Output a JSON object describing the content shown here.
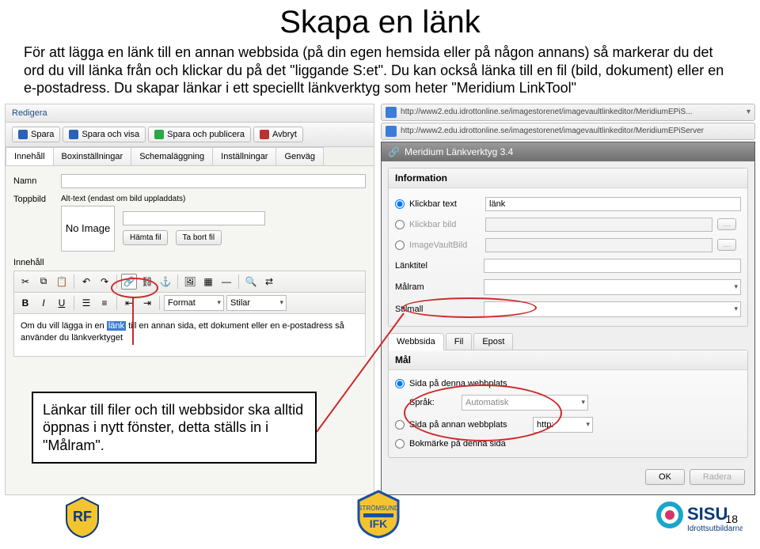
{
  "title": "Skapa en länk",
  "intro": "För att lägga en länk till en annan webbsida (på din egen hemsida eller på någon annans) så markerar du det ord du vill länka från och klickar du på det \"liggande S:et\". Du kan också länka till en fil (bild, dokument) eller en e-postadress. Du skapar länkar i ett speciellt länkverktyg som heter \"Meridium LinkTool\"",
  "callout": "Länkar till filer och till webbsidor ska alltid öppnas i nytt fönster, detta ställs in i \"Målram\".",
  "left": {
    "redigera": "Redigera",
    "toolbar": {
      "spara": "Spara",
      "spara_visa": "Spara och visa",
      "spara_pub": "Spara och publicera",
      "avbryt": "Avbryt"
    },
    "tabs": [
      "Innehåll",
      "Boxinställningar",
      "Schemaläggning",
      "Inställningar",
      "Genväg"
    ],
    "labels": {
      "namn": "Namn",
      "toppbild": "Toppbild",
      "innehall": "Innehåll",
      "alt": "Alt-text (endast om bild uppladdats)"
    },
    "noimage": "No Image",
    "btns": {
      "hamta": "Hämta fil",
      "tabort": "Ta bort fil"
    },
    "format_label": "Format",
    "stilar_label": "Stilar",
    "editor_text_before": "Om du vill lägga in en ",
    "editor_text_highlight": "länk",
    "editor_text_after": " till en annan sida, ett dokument eller en e-postadress så använder du länkverktyget"
  },
  "right": {
    "url1": "http://www2.edu.idrottonline.se/imagestorenet/imagevaultlinkeditor/MeridiumEPiS...",
    "url2": "http://www2.edu.idrottonline.se/imagestorenet/imagevaultlinkeditor/MeridiumEPiServer",
    "mer_title": "Meridium Länkverktyg 3.4",
    "info_h": "Information",
    "r1": "Klickbar text",
    "r1_val": "länk",
    "r2": "Klickbar bild",
    "r3": "ImageVaultBild",
    "r4": "Länktitel",
    "r5": "Målram",
    "r6": "Stilmall",
    "mtabs": [
      "Webbsida",
      "Fil",
      "Epost"
    ],
    "mal_h": "Mål",
    "m1": "Sida på denna webbplats",
    "m_sprak": "Språk:",
    "m_auto": "Automatisk",
    "m2": "Sida på annan webbplats",
    "m2_proto": "http:",
    "m3": "Bokmärke på denna sida",
    "ok": "OK",
    "radera": "Radera"
  },
  "pagenum": "18"
}
